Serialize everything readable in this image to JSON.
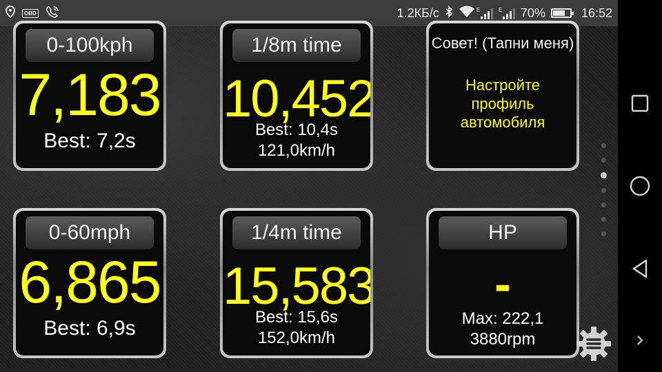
{
  "status": {
    "obd_label": "OBD",
    "speed": "1.2КБ/с",
    "network_e1": "E",
    "network_e2": "E",
    "battery": "70%",
    "battery_level": 0.7,
    "time": "16:52"
  },
  "tiles": {
    "t0100": {
      "header": "0-100kph",
      "value": "7,183",
      "best": "Best: 7,2s"
    },
    "t18": {
      "header": "1/8m time",
      "value": "10,452",
      "best": "Best: 10,4s",
      "speed": "121,0km/h"
    },
    "advice": {
      "title": "Совет! (Тапни меня)",
      "line1": "Настройте",
      "line2": "профиль",
      "line3": "автомобиля"
    },
    "t060": {
      "header": "0-60mph",
      "value": "6,865",
      "best": "Best: 6,9s"
    },
    "t14": {
      "header": "1/4m time",
      "value": "15,583",
      "best": "Best: 15,6s",
      "speed": "152,0km/h"
    },
    "hp": {
      "header": "HP",
      "value": "-",
      "max": "Max: 222,1",
      "rpm": "3880rpm"
    }
  },
  "pager": {
    "count": 7,
    "active": 2
  },
  "icons": {
    "location": "location-icon",
    "obd": "obd-icon",
    "call": "wifi-call-icon",
    "bluetooth": "bluetooth-icon",
    "wifi": "wifi-icon",
    "battery": "battery-icon",
    "settings": "settings-gear-icon",
    "square": "recent-apps-icon",
    "circle": "home-icon",
    "back": "back-icon",
    "chevron": "chevron-right-icon"
  }
}
